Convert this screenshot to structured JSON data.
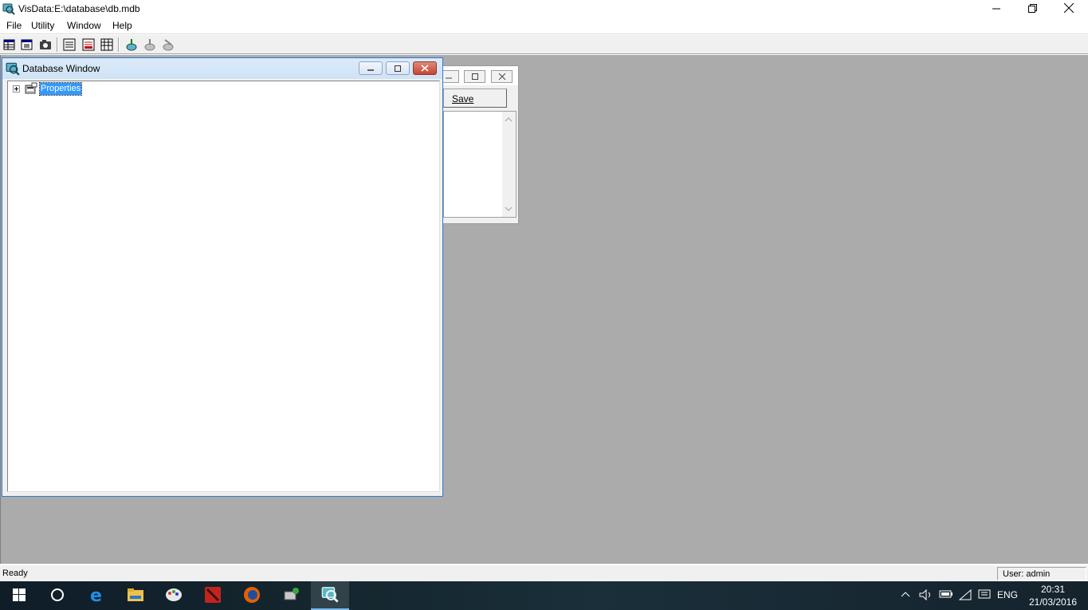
{
  "app": {
    "title": "VisData:E:\\database\\db.mdb",
    "window_controls": [
      "minimize",
      "restore",
      "close"
    ]
  },
  "menu": {
    "items": [
      "File",
      "Utility",
      "Window",
      "Help"
    ]
  },
  "toolbar": {
    "icons": [
      "table-recordset-icon",
      "dynaset-icon",
      "snapshot-icon",
      "form-control-icon",
      "data-control-icon",
      "grid-icon",
      "begin-transaction-icon",
      "commit-icon",
      "rollback-icon"
    ]
  },
  "sql_window": {
    "save_label": "Save"
  },
  "database_window": {
    "title": "Database Window",
    "tree": [
      {
        "label": "Properties",
        "selected": true,
        "expanded": false
      }
    ]
  },
  "statusbar": {
    "left": "Ready",
    "user": "User: admin"
  },
  "taskbar": {
    "apps": [
      "start-icon",
      "cortana-icon",
      "edge-icon",
      "file-explorer-icon",
      "paint-icon",
      "dota-icon",
      "firefox-icon",
      "network-app-icon",
      "visdata-icon"
    ],
    "language": "ENG",
    "time": "20:31",
    "date": "21/03/2016"
  },
  "colors": {
    "mdi_background": "#ababab",
    "selection": "#3399ff",
    "taskbar": "#14262e"
  }
}
